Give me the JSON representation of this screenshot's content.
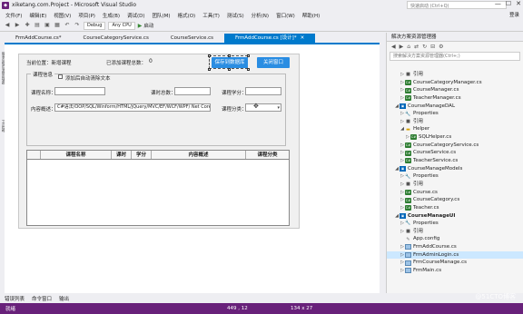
{
  "window": {
    "title": "xiketang.com.Project - Microsoft Visual Studio",
    "quick_launch": "快速启动 (Ctrl+Q)"
  },
  "menu": [
    "文件(F)",
    "编辑(E)",
    "视图(V)",
    "项目(P)",
    "生成(B)",
    "调试(D)",
    "团队(M)",
    "格式(O)",
    "工具(T)",
    "测试(S)",
    "分析(N)",
    "窗口(W)",
    "帮助(H)"
  ],
  "menu_user": "登录",
  "toolbar": {
    "config": "Debug",
    "platform": "Any CPU",
    "start": "启动"
  },
  "tabs": [
    {
      "label": "FrmAddCourse.cs*",
      "active": false
    },
    {
      "label": "CourseCategoryService.cs",
      "active": false
    },
    {
      "label": "CourseService.cs",
      "active": false
    },
    {
      "label": "FrmAddCourse.cs [设计]*",
      "active": true
    }
  ],
  "form": {
    "location_label": "当前位置：新增课程",
    "added_label": "已添加课程总数：",
    "added_count": "0",
    "save_button": "保存到数据库",
    "close_button": "关闭窗口",
    "group_title": "课程信息",
    "checkbox_label": "添加后自动清除文本",
    "course_name_label": "课程名称：",
    "hours_label": "课时总数：",
    "credit_label": "课程学分：",
    "content_label": "内容概述：",
    "content_value": "C#语法/OOP/SQL/Winform/HTML/jQuery/MVC/EF/WCF/WPF/ Net Core",
    "category_label": "课程分类："
  },
  "grid": {
    "columns": [
      "课程名称",
      "课时",
      "学分",
      "内容概述",
      "课程分类"
    ]
  },
  "left_strip": [
    "服务器资源管理器",
    "工具箱"
  ],
  "bottom_tabs": [
    "错误列表",
    "命令窗口",
    "输出"
  ],
  "status": {
    "ready": "就绪",
    "pos1": "449 , 12",
    "pos2": "134 x 27"
  },
  "solution_explorer": {
    "title": "解决方案资源管理器",
    "search_placeholder": "搜索解决方案资源管理器(Ctrl+;)",
    "items": [
      {
        "text": "引用",
        "indent": 2,
        "icon": "reference-icon",
        "arrow": "▷"
      },
      {
        "text": "CourseCategoryManager.cs",
        "indent": 2,
        "icon": "cs-file-icon",
        "arrow": "▷"
      },
      {
        "text": "CourseManager.cs",
        "indent": 2,
        "icon": "cs-file-icon",
        "arrow": "▷"
      },
      {
        "text": "TeacherManager.cs",
        "indent": 2,
        "icon": "cs-file-icon",
        "arrow": "▷"
      },
      {
        "text": "CourseManageDAL",
        "indent": 1,
        "icon": "project-icon",
        "arrow": "◢"
      },
      {
        "text": "Properties",
        "indent": 2,
        "icon": "wrench-icon",
        "arrow": "▷"
      },
      {
        "text": "引用",
        "indent": 2,
        "icon": "reference-icon",
        "arrow": "▷"
      },
      {
        "text": "Helper",
        "indent": 2,
        "icon": "folder-icon",
        "arrow": "◢"
      },
      {
        "text": "SQLHelper.cs",
        "indent": 3,
        "icon": "cs-file-icon",
        "arrow": "▷"
      },
      {
        "text": "CourseCategoryService.cs",
        "indent": 2,
        "icon": "cs-file-icon",
        "arrow": "▷"
      },
      {
        "text": "CourseService.cs",
        "indent": 2,
        "icon": "cs-file-icon",
        "arrow": "▷"
      },
      {
        "text": "TeacherService.cs",
        "indent": 2,
        "icon": "cs-file-icon",
        "arrow": "▷"
      },
      {
        "text": "CourseManageModels",
        "indent": 1,
        "icon": "project-icon",
        "arrow": "◢"
      },
      {
        "text": "Properties",
        "indent": 2,
        "icon": "wrench-icon",
        "arrow": "▷"
      },
      {
        "text": "引用",
        "indent": 2,
        "icon": "reference-icon",
        "arrow": "▷"
      },
      {
        "text": "Course.cs",
        "indent": 2,
        "icon": "cs-file-icon",
        "arrow": "▷"
      },
      {
        "text": "CourseCategory.cs",
        "indent": 2,
        "icon": "cs-file-icon",
        "arrow": "▷"
      },
      {
        "text": "Teacher.cs",
        "indent": 2,
        "icon": "cs-file-icon",
        "arrow": "▷"
      },
      {
        "text": "CourseManageUI",
        "indent": 1,
        "icon": "project-icon",
        "arrow": "◢",
        "bold": true
      },
      {
        "text": "Properties",
        "indent": 2,
        "icon": "wrench-icon",
        "arrow": "▷"
      },
      {
        "text": "引用",
        "indent": 2,
        "icon": "reference-icon",
        "arrow": "▷"
      },
      {
        "text": "App.config",
        "indent": 2,
        "icon": "config-icon",
        "arrow": ""
      },
      {
        "text": "FrmAddCourse.cs",
        "indent": 2,
        "icon": "form-icon",
        "arrow": "▷"
      },
      {
        "text": "FrmAdminLogin.cs",
        "indent": 2,
        "icon": "form-icon",
        "arrow": "▷",
        "selected": true
      },
      {
        "text": "FrmCourseManage.cs",
        "indent": 2,
        "icon": "form-icon",
        "arrow": "▷"
      },
      {
        "text": "FrmMain.cs",
        "indent": 2,
        "icon": "form-icon",
        "arrow": "▷"
      }
    ]
  },
  "watermark": "@51CTO博客"
}
